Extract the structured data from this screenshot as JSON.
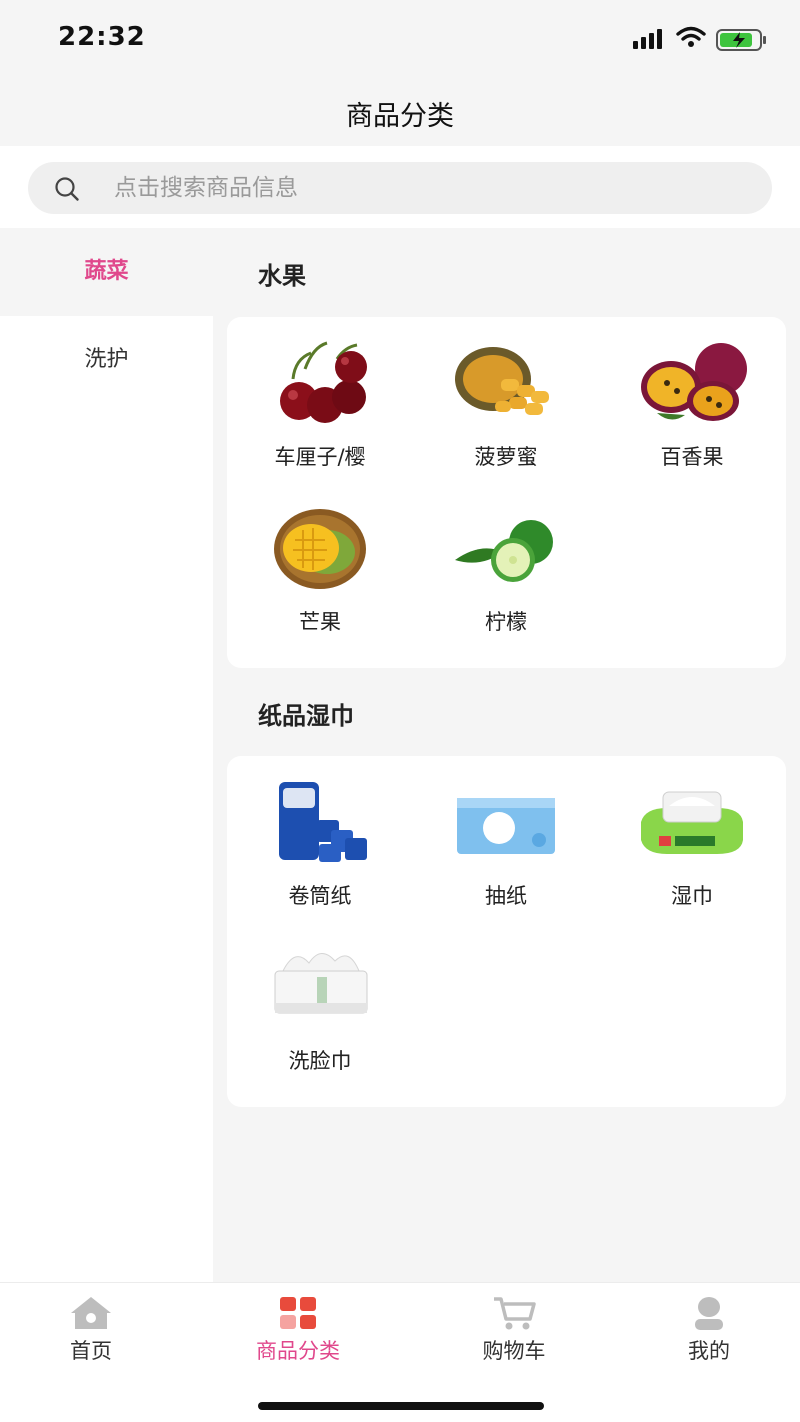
{
  "status_bar": {
    "time": "22:32"
  },
  "header": {
    "title": "商品分类"
  },
  "search": {
    "placeholder": "点击搜索商品信息"
  },
  "sidebar": {
    "items": [
      {
        "label": "蔬菜",
        "active": true
      },
      {
        "label": "洗护",
        "active": false
      }
    ]
  },
  "sections": [
    {
      "title": "水果",
      "items": [
        {
          "label": "车厘子/樱",
          "icon": "cherry-icon"
        },
        {
          "label": "菠萝蜜",
          "icon": "jackfruit-icon"
        },
        {
          "label": "百香果",
          "icon": "passionfruit-icon"
        },
        {
          "label": "芒果",
          "icon": "mango-icon"
        },
        {
          "label": "柠檬",
          "icon": "lime-icon"
        }
      ]
    },
    {
      "title": "纸品湿巾",
      "items": [
        {
          "label": "卷筒纸",
          "icon": "toilet-roll-icon"
        },
        {
          "label": "抽纸",
          "icon": "tissue-box-icon"
        },
        {
          "label": "湿巾",
          "icon": "wet-wipes-icon"
        },
        {
          "label": "洗脸巾",
          "icon": "face-towel-icon"
        }
      ]
    }
  ],
  "tabbar": {
    "tabs": [
      {
        "label": "首页",
        "icon": "home-icon",
        "active": false
      },
      {
        "label": "商品分类",
        "icon": "category-icon",
        "active": true
      },
      {
        "label": "购物车",
        "icon": "cart-icon",
        "active": false
      },
      {
        "label": "我的",
        "icon": "profile-icon",
        "active": false
      }
    ]
  },
  "colors": {
    "accent": "#e0488c",
    "background": "#f5f5f5"
  }
}
